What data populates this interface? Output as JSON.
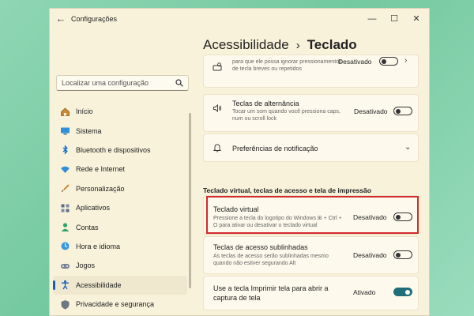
{
  "window": {
    "title": "Configurações",
    "back": "←",
    "minimize": "—",
    "maximize": "☐",
    "close": "✕"
  },
  "search": {
    "placeholder": "Localizar uma configuração",
    "icon": "search-icon"
  },
  "nav": {
    "items": [
      {
        "label": "Início",
        "icon": "home-icon"
      },
      {
        "label": "Sistema",
        "icon": "monitor-icon"
      },
      {
        "label": "Bluetooth e dispositivos",
        "icon": "bluetooth-icon"
      },
      {
        "label": "Rede e Internet",
        "icon": "wifi-icon"
      },
      {
        "label": "Personalização",
        "icon": "brush-icon"
      },
      {
        "label": "Aplicativos",
        "icon": "apps-icon"
      },
      {
        "label": "Contas",
        "icon": "person-icon"
      },
      {
        "label": "Hora e idioma",
        "icon": "globe-clock-icon"
      },
      {
        "label": "Jogos",
        "icon": "gamepad-icon"
      },
      {
        "label": "Acessibilidade",
        "icon": "accessibility-icon",
        "active": true
      },
      {
        "label": "Privacidade e segurança",
        "icon": "shield-icon"
      }
    ]
  },
  "header": {
    "breadcrumb_parent": "Acessibilidade",
    "separator": "›",
    "breadcrumb_current": "Teclado"
  },
  "rows": {
    "filter_keys": {
      "desc": "para que ele possa ignorar pressionamentos de tecla breves ou repetidos",
      "status": "Desativado",
      "on": false,
      "icon": "keyboard-timer-icon"
    },
    "toggle_keys": {
      "title": "Teclas de alternância",
      "desc": "Tocar um som quando você pressiona caps, num ou scroll lock",
      "status": "Desativado",
      "on": false,
      "icon": "speaker-icon"
    },
    "notifications": {
      "title": "Preferências de notificação",
      "icon": "bell-icon"
    }
  },
  "section": {
    "heading": "Teclado virtual, teclas de acesso e tela de impressão"
  },
  "rows2": {
    "virtual_keyboard": {
      "title": "Teclado virtual",
      "desc": "Pressione a tecla do logotipo do Windows ⊞ + Ctrl + O para ativar ou desativar o teclado virtual",
      "status": "Desativado",
      "on": false
    },
    "access_keys": {
      "title": "Teclas de acesso sublinhadas",
      "desc": "As teclas de acesso serão sublinhadas mesmo quando não estiver segurando Alt",
      "status": "Desativado",
      "on": false
    },
    "print_screen": {
      "title": "Use a tecla Imprimir tela para abrir a captura de tela",
      "status": "Ativado",
      "on": true
    }
  },
  "colors": {
    "accent": "#1f6f7a",
    "highlight": "#d22a2a",
    "window_bg": "#f8f2da",
    "desktop": "#8fd6b4"
  }
}
